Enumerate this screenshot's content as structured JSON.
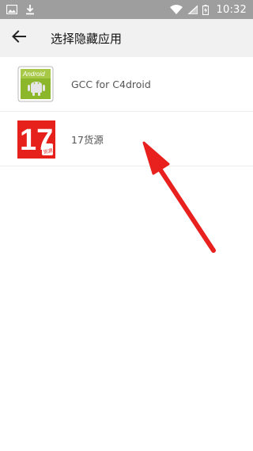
{
  "status_bar": {
    "time": "10:32",
    "icons": [
      "image-icon",
      "download-icon",
      "wifi-icon",
      "signal-icon",
      "battery-icon"
    ]
  },
  "app_bar": {
    "title": "选择隐藏应用",
    "back_icon": "arrow-left-icon"
  },
  "apps": [
    {
      "label": "GCC for C4droid",
      "icon": "android-box-icon",
      "icon_text": "Android"
    },
    {
      "label": "17货源",
      "icon": "app-17-icon",
      "icon_text": "17",
      "icon_badge": "货源"
    }
  ],
  "annotation": {
    "color": "#e8211f"
  }
}
